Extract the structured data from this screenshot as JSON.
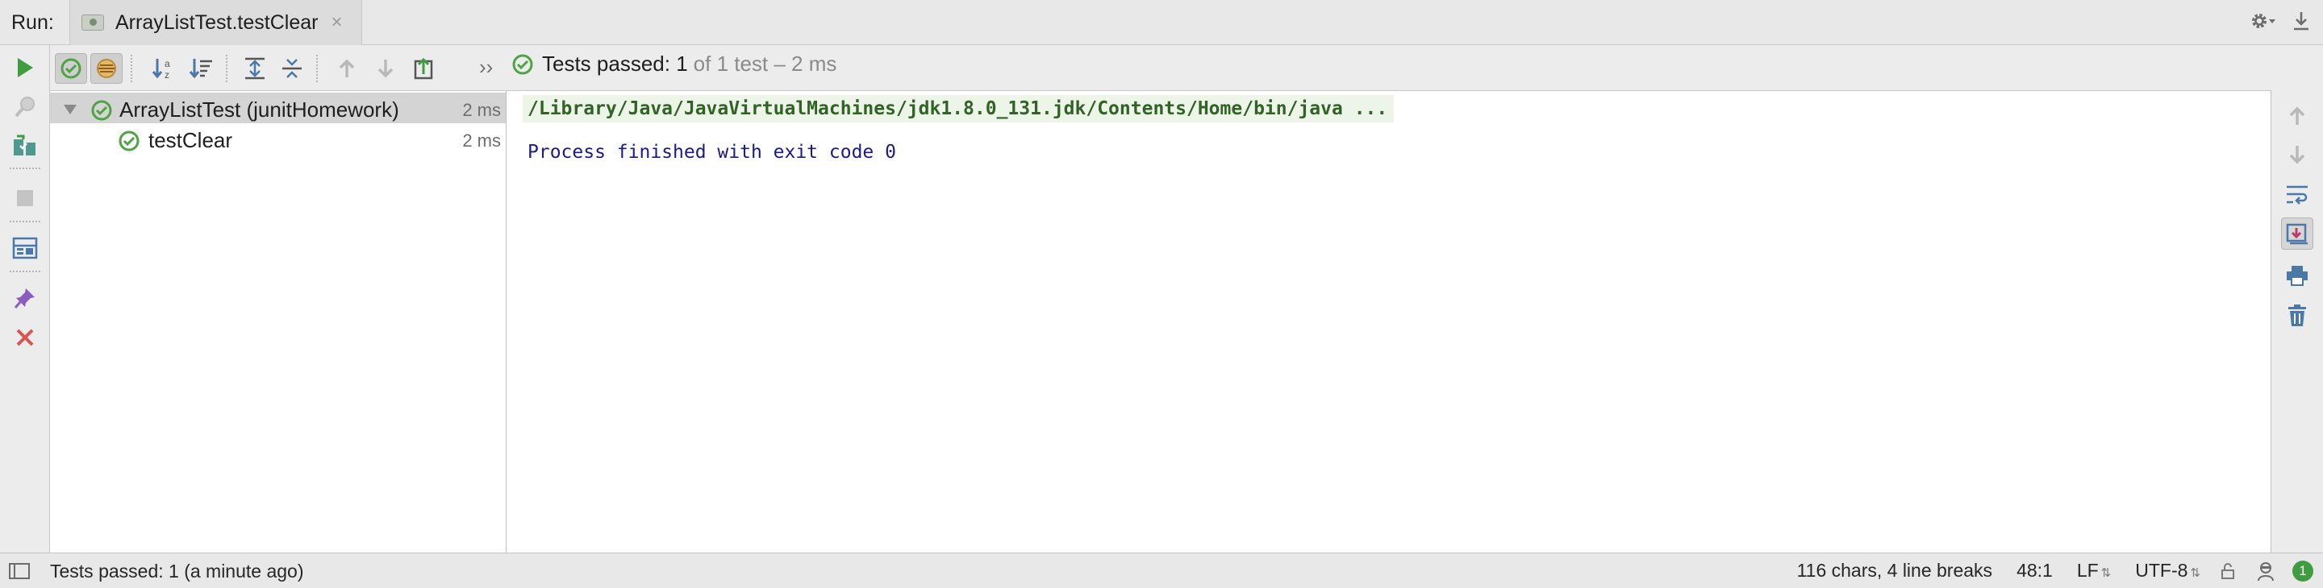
{
  "header": {
    "run_label": "Run:",
    "tab_title": "ArrayListTest.testClear",
    "tab_close": "×"
  },
  "test_toolbar": {
    "more": "››",
    "status_passed": "Tests passed: 1",
    "status_detail": "of 1 test – 2 ms"
  },
  "test_tree": {
    "rows": [
      {
        "label": "ArrayListTest (junitHomework)",
        "time": "2 ms",
        "status": "passed",
        "expanded": true
      },
      {
        "label": "testClear",
        "time": "2 ms",
        "status": "passed"
      }
    ]
  },
  "console": {
    "command": "/Library/Java/JavaVirtualMachines/jdk1.8.0_131.jdk/Contents/Home/bin/java ...",
    "exit_message": "Process finished with exit code 0"
  },
  "status_bar": {
    "message": "Tests passed: 1 (a minute ago)",
    "chars": "116 chars, 4 line breaks",
    "position": "48:1",
    "line_separator": "LF",
    "encoding": "UTF-8",
    "notifications": "1"
  },
  "colors": {
    "pass_green": "#4ea343",
    "run_green": "#3f9c3f",
    "console_cmd": "#316326",
    "console_exit": "#1a1a8c",
    "stop_red": "#d9534f"
  }
}
